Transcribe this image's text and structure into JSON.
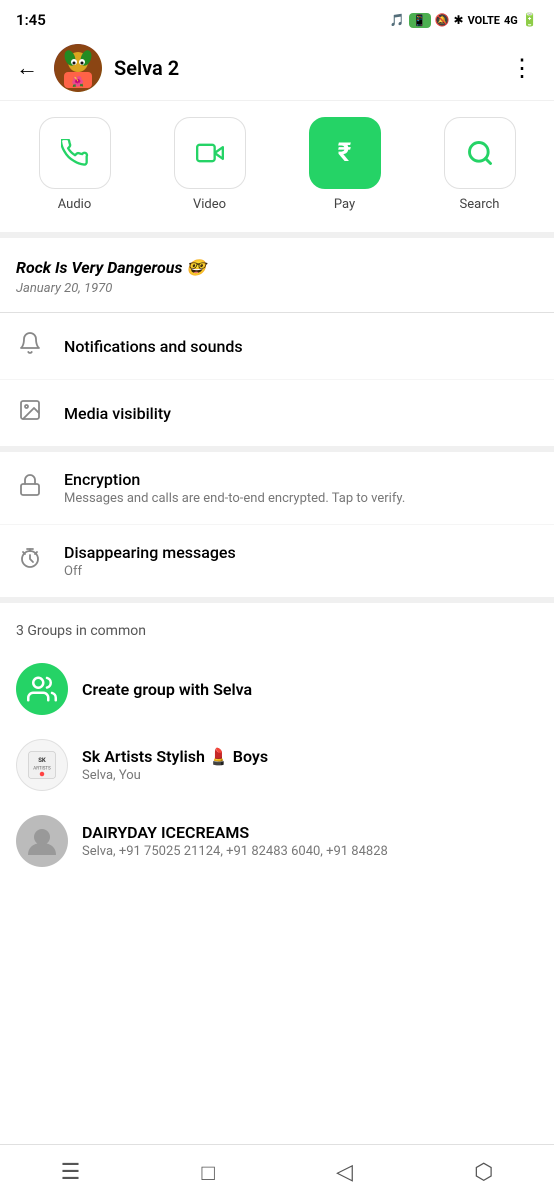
{
  "statusBar": {
    "time": "1:45",
    "icons": "🎵 📱"
  },
  "header": {
    "backLabel": "←",
    "name": "Selva 2",
    "moreLabel": "⋮",
    "avatarEmoji": "🦁"
  },
  "actions": [
    {
      "id": "audio",
      "label": "Audio",
      "icon": "phone",
      "filled": false
    },
    {
      "id": "video",
      "label": "Video",
      "icon": "video",
      "filled": false
    },
    {
      "id": "pay",
      "label": "Pay",
      "icon": "₹",
      "filled": true
    },
    {
      "id": "search",
      "label": "Search",
      "icon": "search",
      "filled": false
    }
  ],
  "status": {
    "text": "Rock Is Very Dangerous 🤓",
    "date": "January 20, 1970"
  },
  "settings": [
    {
      "id": "notifications",
      "icon": "bell",
      "title": "Notifications and sounds",
      "subtitle": ""
    },
    {
      "id": "media",
      "icon": "image",
      "title": "Media visibility",
      "subtitle": ""
    }
  ],
  "securitySettings": [
    {
      "id": "encryption",
      "icon": "lock",
      "title": "Encryption",
      "subtitle": "Messages and calls are end-to-end encrypted. Tap to verify."
    },
    {
      "id": "disappearing",
      "icon": "timer",
      "title": "Disappearing messages",
      "subtitle": "Off"
    }
  ],
  "groups": {
    "label": "3 Groups in common",
    "createLabel": "Create group with Selva",
    "items": [
      {
        "id": "sk-artists",
        "name": "Sk Artists Stylish 💄 Boys",
        "members": "Selva, You",
        "avatarType": "sk"
      },
      {
        "id": "dairyday",
        "name": "DAIRYDAY ICECREAMS",
        "members": "Selva, +91 75025 21124, +91 82483 6040, +91 84828",
        "avatarType": "person"
      }
    ]
  },
  "bottomNav": {
    "menu": "☰",
    "home": "□",
    "back": "◁",
    "recent": "⬡"
  }
}
